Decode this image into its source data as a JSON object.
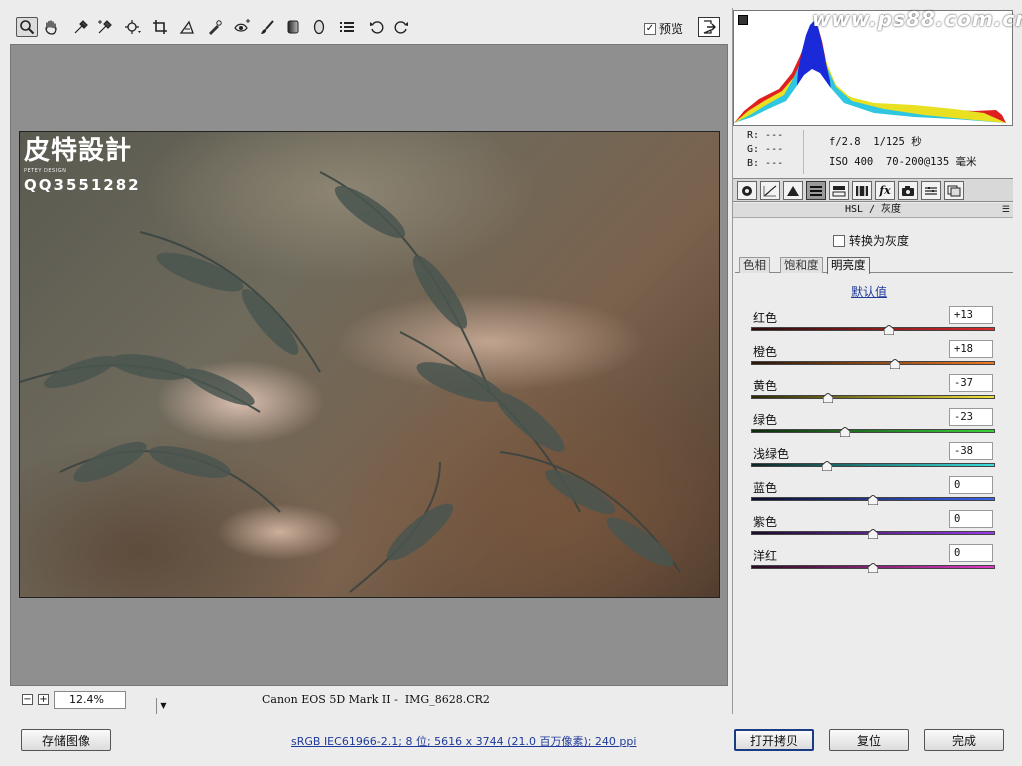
{
  "toolbar": {
    "tools": [
      {
        "name": "zoom-tool",
        "icon": "magnifier",
        "active": true
      },
      {
        "name": "hand-tool",
        "icon": "hand"
      },
      {
        "name": "white-balance-tool",
        "icon": "eyedropper"
      },
      {
        "name": "color-sampler-tool",
        "icon": "eyedropper-plus"
      },
      {
        "name": "targeted-adjustment-tool",
        "icon": "target"
      },
      {
        "name": "crop-tool",
        "icon": "crop"
      },
      {
        "name": "straighten-tool",
        "icon": "angle"
      },
      {
        "name": "spot-removal-tool",
        "icon": "brush-spot"
      },
      {
        "name": "red-eye-tool",
        "icon": "eye"
      },
      {
        "name": "adjustment-brush-tool",
        "icon": "brush"
      },
      {
        "name": "graduated-filter-tool",
        "icon": "gradient-rect"
      },
      {
        "name": "radial-filter-tool",
        "icon": "ellipse"
      },
      {
        "name": "preferences-tool",
        "icon": "list"
      },
      {
        "name": "rotate-ccw-tool",
        "icon": "rotate-left"
      },
      {
        "name": "rotate-cw-tool",
        "icon": "rotate-right"
      }
    ],
    "preview_label": "预览",
    "preview_checked": true
  },
  "watermark": {
    "title": "皮特設計",
    "subtitle": "PETEY DESIGN",
    "qq": "QQ3551282"
  },
  "statusbar": {
    "zoom": "12.4%",
    "camera": "Canon EOS 5D Mark II",
    "separator": " -  ",
    "filename": "IMG_8628.CR2"
  },
  "bottom": {
    "save_label": "存储图像",
    "workflow_text": "sRGB IEC61966-2.1; 8 位; 5616 x 3744 (21.0 百万像素); 240 ppi",
    "open_copy_label": "打开拷贝",
    "reset_label": "复位",
    "done_label": "完成"
  },
  "site_watermark": "www.ps88.com.cn",
  "readout": {
    "r": "R: ---",
    "g": "G: ---",
    "b": "B: ---",
    "aperture": "f/2.8",
    "shutter": "1/125 秒",
    "iso": "ISO 400",
    "lens": "70-200@135 毫米"
  },
  "panel": {
    "section_title": "HSL / 灰度",
    "grayscale_label": "转换为灰度",
    "grayscale_checked": false,
    "tabs": [
      "色相",
      "饱和度",
      "明亮度"
    ],
    "active_tab": 2,
    "default_link": "默认值",
    "sliders": [
      {
        "label": "红色",
        "value": "+13",
        "num": 13,
        "from": "#2a0c0c",
        "to": "#e02a2a"
      },
      {
        "label": "橙色",
        "value": "+18",
        "num": 18,
        "from": "#2a1608",
        "to": "#f07a24"
      },
      {
        "label": "黄色",
        "value": "-37",
        "num": -37,
        "from": "#2a2808",
        "to": "#efe23a"
      },
      {
        "label": "绿色",
        "value": "-23",
        "num": -23,
        "from": "#0c2a0c",
        "to": "#3ad13a"
      },
      {
        "label": "浅绿色",
        "value": "-38",
        "num": -38,
        "from": "#0c2626",
        "to": "#3ae0e0"
      },
      {
        "label": "蓝色",
        "value": "0",
        "num": 0,
        "from": "#0c0c2a",
        "to": "#3a64ef"
      },
      {
        "label": "紫色",
        "value": "0",
        "num": 0,
        "from": "#1a0c2a",
        "to": "#9a3aef"
      },
      {
        "label": "洋红",
        "value": "0",
        "num": 0,
        "from": "#2a0c22",
        "to": "#e03ac8"
      }
    ],
    "slider_min": -100,
    "slider_max": 100
  }
}
